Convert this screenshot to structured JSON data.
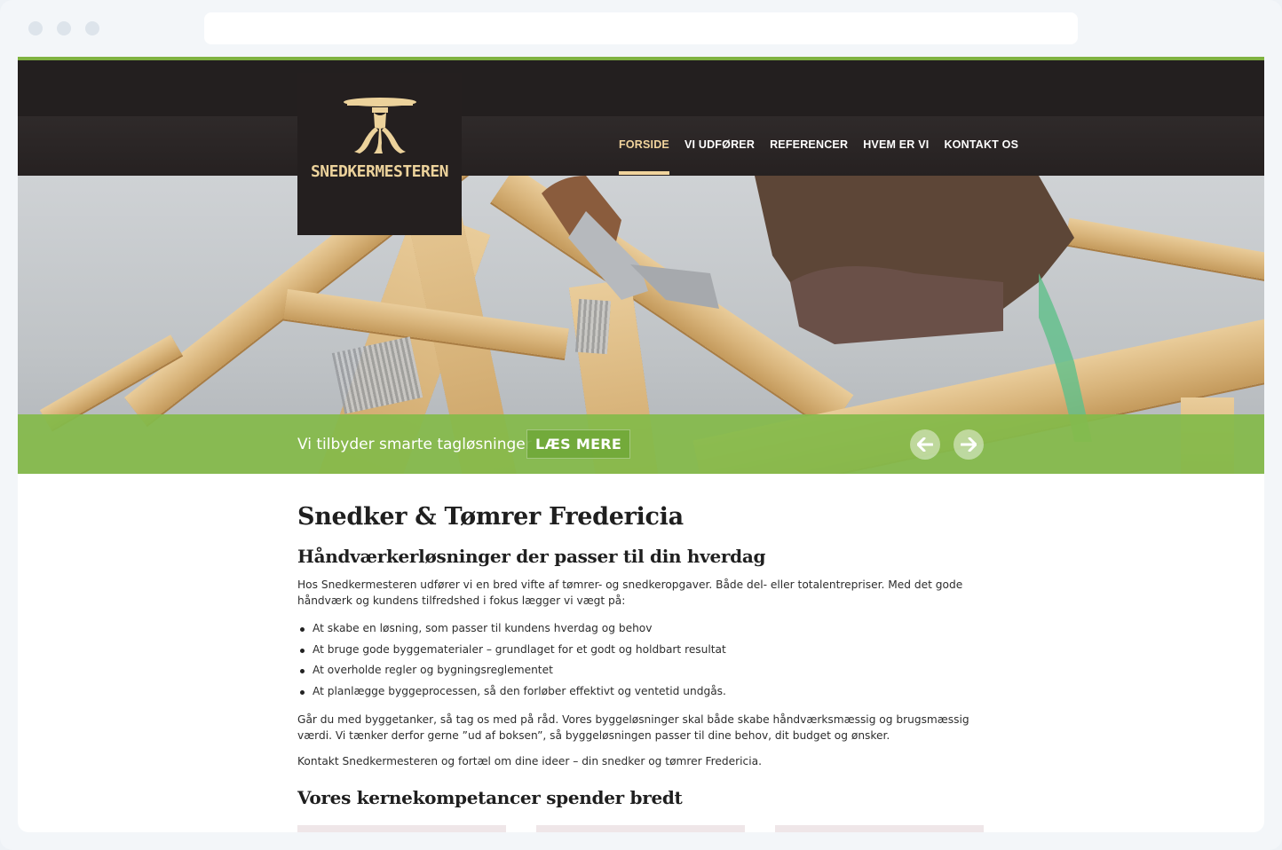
{
  "site": {
    "logo_text": "SNEDKERMESTEREN"
  },
  "nav": {
    "items": [
      {
        "label": "FORSIDE",
        "active": true
      },
      {
        "label": "VI UDFØRER",
        "active": false
      },
      {
        "label": "REFERENCER",
        "active": false
      },
      {
        "label": "HVEM ER VI",
        "active": false
      },
      {
        "label": "KONTAKT OS",
        "active": false
      }
    ]
  },
  "hero": {
    "caption": "Vi tilbyder smarte tagløsninger",
    "button_label": "LÆS MERE",
    "prev_icon": "arrow-left-icon",
    "next_icon": "arrow-right-icon"
  },
  "content": {
    "title": "Snedker & Tømrer Fredericia",
    "subtitle": "Håndværkerløsninger der passer til din hverdag",
    "intro": "Hos Snedkermesteren udfører vi en bred vifte af tømrer- og snedkeropgaver. Både del- eller totalentrepriser. Med det gode håndværk og kundens tilfredshed i fokus lægger vi vægt på:",
    "bullets": [
      "At skabe en løsning, som passer til kundens hverdag og behov",
      "At bruge gode byggematerialer – grundlaget for et godt og holdbart resultat",
      "At overholde regler og bygningsreglementet",
      "At planlægge byggeprocessen, så den forløber effektivt og ventetid undgås."
    ],
    "paragraph2": "Går du med byggetanker, så tag os med på råd. Vores byggeløsninger skal både skabe håndværksmæssig og brugsmæssig værdi. Vi tænker derfor gerne ”ud af boksen”, så byggeløsningen passer til dine behov, dit budget og ønsker.",
    "paragraph3": "Kontakt Snedkermesteren og fortæl om dine ideer – din snedker og tømrer Fredericia.",
    "section_title": "Vores kernekompetancer spender bredt"
  },
  "colors": {
    "accent_green": "#84ba4a",
    "header_dark": "#2b2626",
    "nav_active": "#f1d49d"
  }
}
